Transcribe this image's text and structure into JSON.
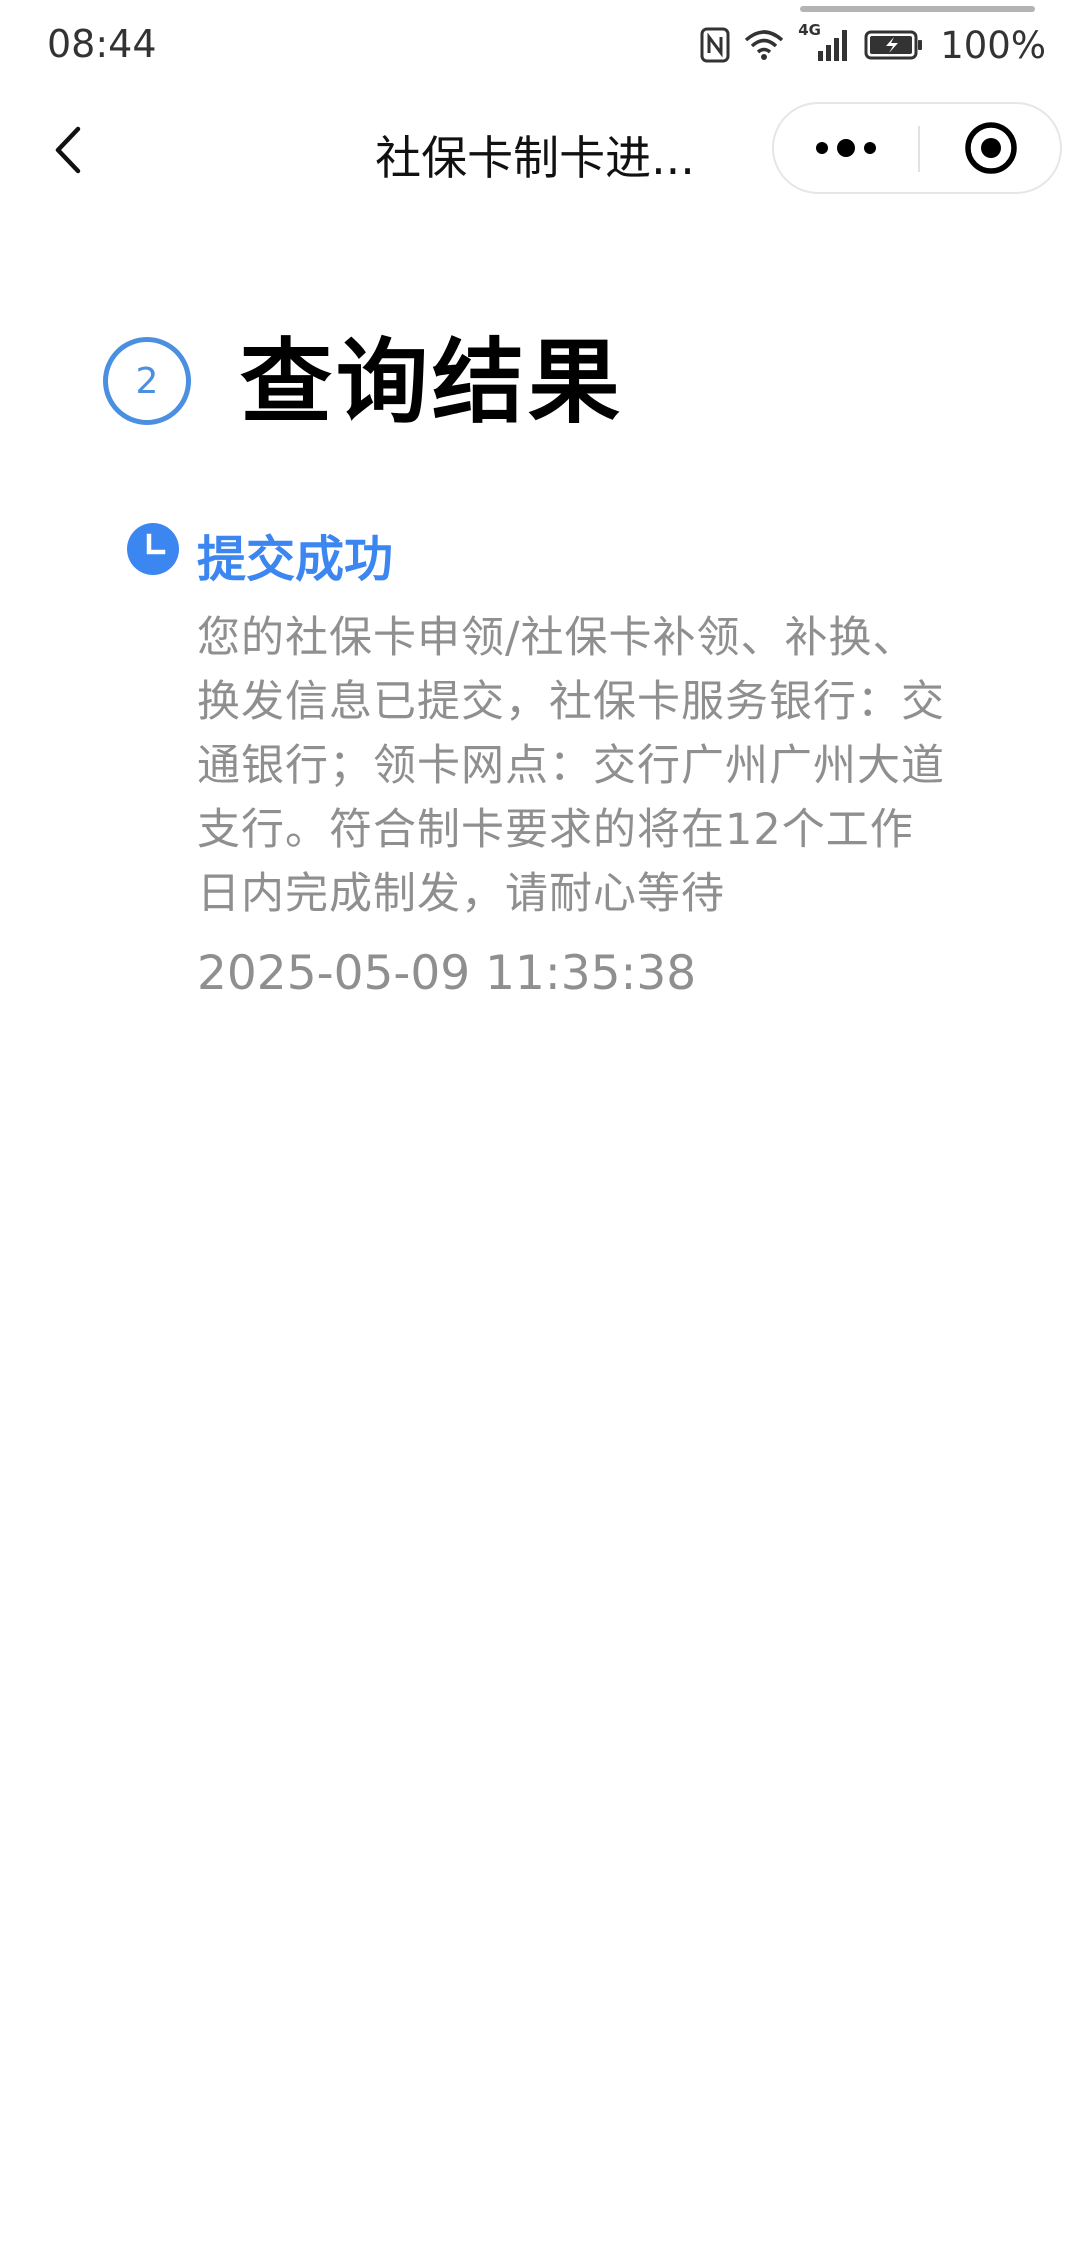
{
  "status_bar": {
    "time": "08:44",
    "network": "4G",
    "battery": "100%",
    "icons": [
      "nfc-icon",
      "wifi-icon",
      "signal-icon",
      "battery-icon"
    ]
  },
  "nav": {
    "back_icon": "chevron-left-icon",
    "title": "社保卡制卡进...",
    "more_icon": "more-dots-icon",
    "close_icon": "target-close-icon"
  },
  "step": {
    "number": "2",
    "title": "查询结果"
  },
  "timeline": {
    "icon": "clock-icon",
    "label": "提交成功",
    "description": "您的社保卡申领/社保卡补领、补换、换发信息已提交，社保卡服务银行：交通银行；领卡网点：交行广州广州大道支行。符合制卡要求的将在12个工作日内完成制发，请耐心等待",
    "time": "2025-05-09 11:35:38"
  },
  "colors": {
    "accent": "#3b86f0",
    "step_ring": "#4b8fe0",
    "muted_text": "#8f8f8f"
  }
}
